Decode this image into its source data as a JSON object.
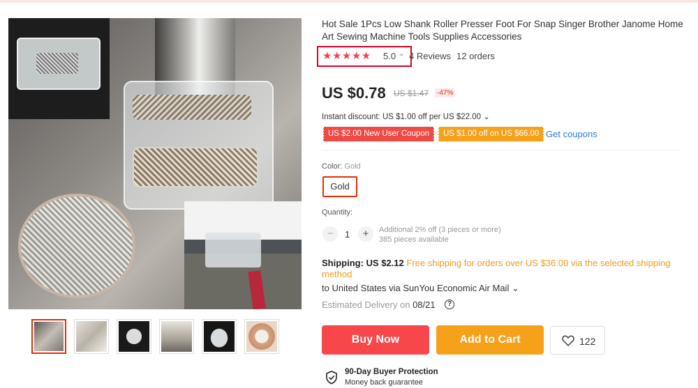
{
  "product": {
    "title": "Hot Sale 1Pcs Low Shank Roller Presser Foot For Snap Singer Brother Janome Home Art Sewing Machine Tools Supplies Accessories",
    "rating": {
      "stars": "★★★★★",
      "value": "5.0",
      "chevron": "⌄",
      "reviews": "4 Reviews",
      "orders": "12 orders"
    }
  },
  "pricing": {
    "price": "US $0.78",
    "original_price": "US $1.47",
    "discount": "-47%",
    "instant_discount": "Instant discount: US $1.00 off per US $22.00 ⌄",
    "coupons": [
      "US $2.00 New User Coupon",
      "US $1.00 off on US $66.00"
    ],
    "get_coupons": "Get coupons"
  },
  "options": {
    "color_label": "Color: ",
    "color_value": "Gold",
    "color_choice": "Gold"
  },
  "quantity": {
    "label": "Quantity:",
    "minus": "−",
    "value": "1",
    "plus": "+",
    "note_line1": "Additional 2% off (3 pieces or more)",
    "note_line2": "385 pieces available"
  },
  "shipping": {
    "label": "Shipping: US $2.12",
    "free_text": "Free shipping for orders over US $36.00 via the selected shipping method",
    "to": "to United States via SunYou Economic Air Mail ⌄",
    "est_label": "Estimated Delivery on ",
    "est_date": "08/21",
    "help": "?"
  },
  "actions": {
    "buy_now": "Buy Now",
    "add_to_cart": "Add to Cart",
    "wishlist_count": "122"
  },
  "protection": {
    "title": "90-Day Buyer Protection",
    "subtitle": "Money back guarantee"
  },
  "colors": {
    "accent_red": "#f7474b",
    "accent_orange": "#f6a11a",
    "link_blue": "#2c80d6",
    "highlight_box": "#d9001b"
  },
  "icons": [
    "star-icon",
    "chevron-down-icon",
    "help-icon",
    "heart-icon",
    "shield-icon"
  ]
}
